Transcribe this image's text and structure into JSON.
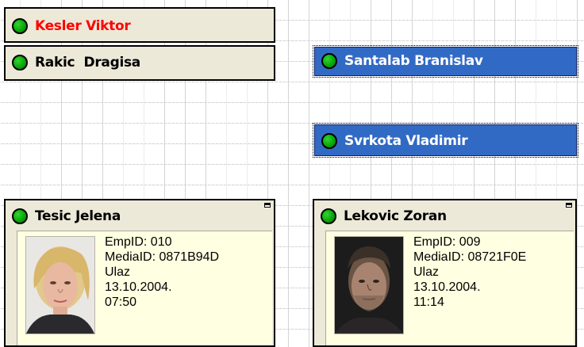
{
  "cards": {
    "kesler": {
      "name": "Kesler Viktor"
    },
    "rakic": {
      "name": "Rakic  Dragisa"
    },
    "santalab": {
      "name": "Santalab Branislav"
    },
    "svrkota": {
      "name": "Svrkota Vladimir"
    },
    "tesic": {
      "name": "Tesic Jelena",
      "details": [
        "EmpID: 010",
        "MediaID: 0871B94D",
        "Ulaz",
        "13.10.2004.",
        "07:50"
      ]
    },
    "lekovic": {
      "name": "Lekovic Zoran",
      "details": [
        "EmpID: 009",
        "MediaID: 08721F0E",
        "Ulaz",
        "13.10.2004.",
        "11:14"
      ]
    }
  },
  "colors": {
    "status_green": "#08a808",
    "alert_red": "#ff0000",
    "selection_blue": "#316ac5",
    "card_bg": "#ece9d8",
    "detail_bg": "#ffffe1"
  },
  "icons": {
    "status": "status-dot-icon",
    "restore": "restore-window-icon",
    "photo": "employee-photo"
  }
}
